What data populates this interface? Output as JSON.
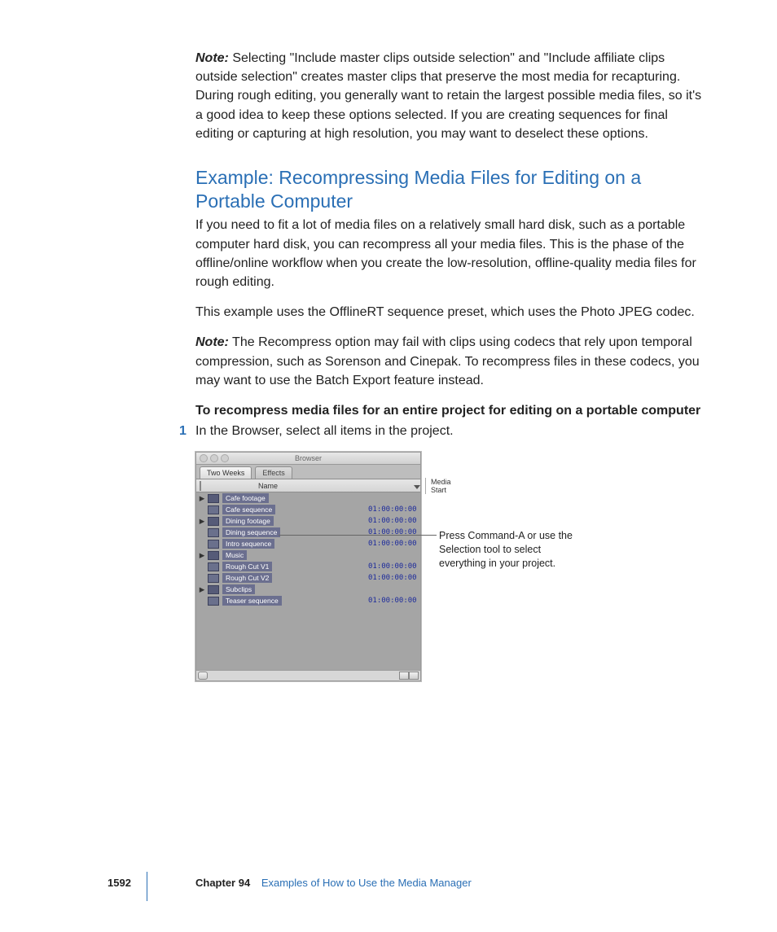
{
  "note1_label": "Note:",
  "note1_text": "  Selecting \"Include master clips outside selection\" and \"Include affiliate clips outside selection\" creates master clips that preserve the most media for recapturing. During rough editing, you generally want to retain the largest possible media files, so it's a good idea to keep these options selected. If you are creating sequences for final editing or capturing at high resolution, you may want to deselect these options.",
  "heading": "Example: Recompressing Media Files for Editing on a Portable Computer",
  "intro1": "If you need to fit a lot of media files on a relatively small hard disk, such as a portable computer hard disk, you can recompress all your media files. This is the phase of the offline/online workflow when you create the low-resolution, offline-quality media files for rough editing.",
  "intro2": "This example uses the OfflineRT sequence preset, which uses the Photo JPEG codec.",
  "note2_label": "Note:",
  "note2_text": "  The Recompress option may fail with clips using codecs that rely upon temporal compression, such as Sorenson and Cinepak. To recompress files in these codecs, you may want to use the Batch Export feature instead.",
  "lead": "To recompress media files for an entire project for editing on a portable computer",
  "step1_num": "1",
  "step1_text": "In the Browser, select all items in the project.",
  "callout": "Press Command-A or use the Selection tool to select everything in your project.",
  "browser": {
    "title": "Browser",
    "tabs": [
      "Two Weeks",
      "Effects"
    ],
    "col_name": "Name",
    "col_media_start": "Media Start",
    "rows": [
      {
        "exp": "▶",
        "name": "Cafe footage",
        "ms": ""
      },
      {
        "exp": "",
        "name": "Cafe sequence",
        "ms": "01:00:00:00"
      },
      {
        "exp": "▶",
        "name": "Dining footage",
        "ms": "01:00:00:00"
      },
      {
        "exp": "",
        "name": "Dining sequence",
        "ms": "01:00:00:00"
      },
      {
        "exp": "",
        "name": "Intro sequence",
        "ms": "01:00:00:00"
      },
      {
        "exp": "▶",
        "name": "Music",
        "ms": ""
      },
      {
        "exp": "",
        "name": "Rough Cut V1",
        "ms": "01:00:00:00"
      },
      {
        "exp": "",
        "name": "Rough Cut V2",
        "ms": "01:00:00:00"
      },
      {
        "exp": "▶",
        "name": "Subclips",
        "ms": ""
      },
      {
        "exp": "",
        "name": "Teaser sequence",
        "ms": "01:00:00:00"
      }
    ]
  },
  "footer": {
    "page": "1592",
    "chapter": "Chapter 94",
    "title": "Examples of How to Use the Media Manager"
  }
}
